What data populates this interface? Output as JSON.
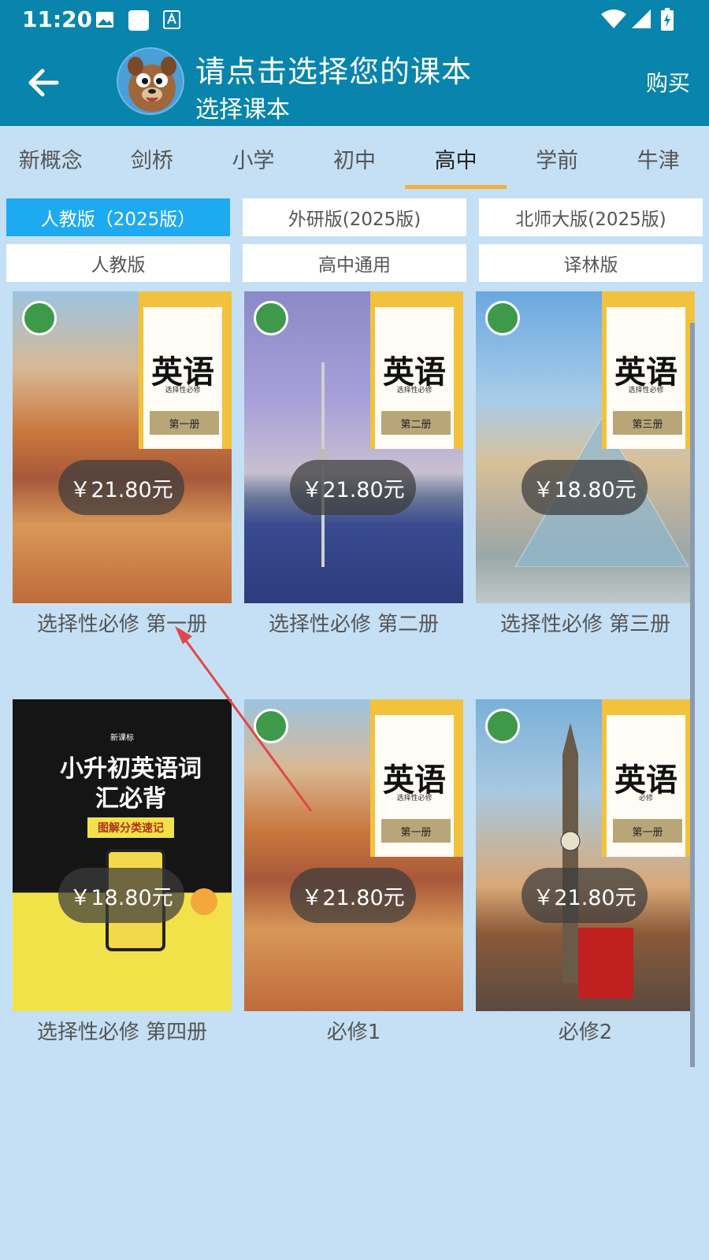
{
  "status": {
    "time": "11:20"
  },
  "header": {
    "title": "请点击选择您的课本",
    "subtitle": "选择课本",
    "buy_label": "购买"
  },
  "tabs": [
    {
      "label": "新概念"
    },
    {
      "label": "剑桥"
    },
    {
      "label": "小学"
    },
    {
      "label": "初中"
    },
    {
      "label": "高中",
      "active": true
    },
    {
      "label": "学前"
    },
    {
      "label": "牛津"
    }
  ],
  "editions": [
    {
      "label": "人教版（2025版）",
      "active": true
    },
    {
      "label": "外研版(2025版)"
    },
    {
      "label": "北师大版(2025版)"
    },
    {
      "label": "人教版"
    },
    {
      "label": "高中通用"
    },
    {
      "label": "译林版"
    }
  ],
  "books": [
    {
      "label": "选择性必修 第一册",
      "price": "￥21.80元",
      "cover_title": "英语",
      "cover_sub": "选择性必修",
      "volume": "第一册"
    },
    {
      "label": "选择性必修 第二册",
      "price": "￥21.80元",
      "cover_title": "英语",
      "cover_sub": "选择性必修",
      "volume": "第二册"
    },
    {
      "label": "选择性必修 第三册",
      "price": "￥18.80元",
      "cover_title": "英语",
      "cover_sub": "选择性必修",
      "volume": "第三册"
    },
    {
      "label": "选择性必修 第四册",
      "price": "￥18.80元",
      "cover_title": "小升初英语词汇必背",
      "cover_sub": "图解分类速记",
      "volume": "新课标"
    },
    {
      "label": "必修1",
      "price": "￥21.80元",
      "cover_title": "英语",
      "cover_sub": "选择性必修",
      "volume": "第一册"
    },
    {
      "label": "必修2",
      "price": "￥21.80元",
      "cover_title": "英语",
      "cover_sub": "必修",
      "volume": "第一册"
    }
  ],
  "colors": {
    "header_bg": "#0884ad",
    "page_bg": "#c5e0f5",
    "active_chip": "#1eaaf1",
    "tab_underline": "#f0b23a"
  }
}
